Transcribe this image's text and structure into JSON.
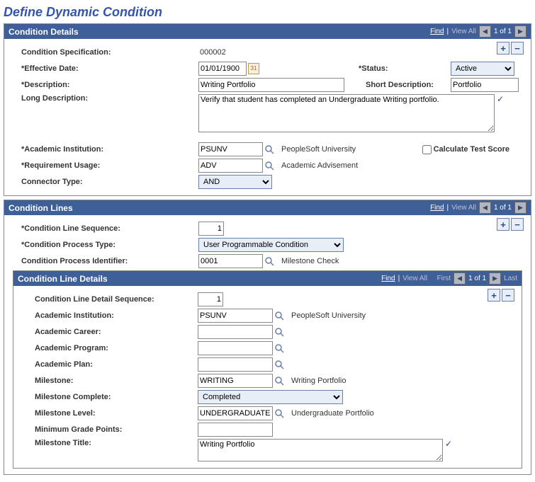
{
  "page_title": "Define Dynamic Condition",
  "condition_details": {
    "title": "Condition Details",
    "find": "Find",
    "view_all": "View All",
    "counter": "1 of 1",
    "labels": {
      "spec": "Condition Specification:",
      "eff_date": "Effective Date:",
      "status": "Status:",
      "desc": "Description:",
      "short_desc": "Short Description:",
      "long_desc": "Long Description:",
      "inst": "Academic Institution:",
      "req_usage": "Requirement Usage:",
      "conn_type": "Connector Type:",
      "calc_test": "Calculate Test Score"
    },
    "values": {
      "spec": "000002",
      "eff_date": "01/01/1900",
      "status": "Active",
      "desc": "Writing Portfolio",
      "short_desc": "Portfolio",
      "long_desc": "Verify that student has completed an Undergraduate Writing portfolio.",
      "inst": "PSUNV",
      "inst_desc": "PeopleSoft University",
      "req_usage": "ADV",
      "req_usage_desc": "Academic Advisement",
      "conn_type": "AND"
    }
  },
  "condition_lines": {
    "title": "Condition Lines",
    "find": "Find",
    "view_all": "View All",
    "counter": "1 of 1",
    "labels": {
      "seq": "Condition Line Sequence:",
      "ptype": "Condition Process Type:",
      "pid": "Condition Process Identifier:"
    },
    "values": {
      "seq": "1",
      "ptype": "User Programmable Condition",
      "pid": "0001",
      "pid_desc": "Milestone Check"
    }
  },
  "condition_line_details": {
    "title": "Condition Line Details",
    "find": "Find",
    "view_all": "View All",
    "first": "First",
    "last": "Last",
    "counter": "1 of 1",
    "labels": {
      "seq": "Condition Line Detail Sequence:",
      "inst": "Academic Institution:",
      "career": "Academic Career:",
      "program": "Academic Program:",
      "plan": "Academic Plan:",
      "milestone": "Milestone:",
      "complete": "Milestone Complete:",
      "level": "Milestone Level:",
      "min_gp": "Minimum Grade Points:",
      "title": "Milestone Title:"
    },
    "values": {
      "seq": "1",
      "inst": "PSUNV",
      "inst_desc": "PeopleSoft University",
      "career": "",
      "program": "",
      "plan": "",
      "milestone": "WRITING",
      "milestone_desc": "Writing Portfolio",
      "complete": "Completed",
      "level": "UNDERGRADUATE",
      "level_desc": "Undergraduate Portfolio",
      "min_gp": "",
      "title": "Writing Portfolio"
    }
  }
}
